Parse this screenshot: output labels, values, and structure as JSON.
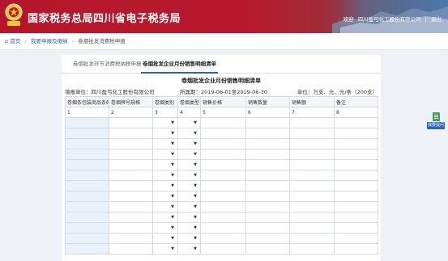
{
  "header": {
    "title": "国家税务总局四川省电子税务局",
    "welcome": "欢迎",
    "company": "四川盈弓化工股份有限公司",
    "divider": "|",
    "logout": "退出",
    "brand_color": "#b5162a"
  },
  "breadcrumb": {
    "home": "首页",
    "level2": "我要申报及缴纳",
    "current": "卷烟批发消费税申报"
  },
  "tabs": [
    {
      "label": "卷烟批发环节消费税纳税申报"
    },
    {
      "label": "卷烟批发企业月份销售明细清单"
    }
  ],
  "form": {
    "title": "卷烟批发企业月份销售明细清单",
    "unit_label": "填报单位：四川盈弓化工股份有限公司",
    "period_label": "所属期：2019-06-01至2019-06-30",
    "money_label": "单位：万支、元、元/条（200支）"
  },
  "table": {
    "headers": [
      "卷烟条包装商品条码",
      "卷烟牌号规格",
      "卷烟类别",
      "卷烟类型",
      "销售价格",
      "销售数量",
      "销售额",
      "备注"
    ],
    "index_row": [
      "1",
      "2",
      "3",
      "4",
      "5",
      "6",
      "7",
      "8"
    ],
    "empty_rows": 13
  },
  "side_widget": {
    "label": "我要提问",
    "icon": "document-icon"
  }
}
